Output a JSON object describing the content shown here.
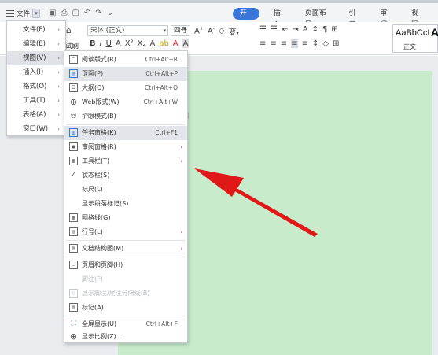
{
  "menubar": {
    "file_button": "文件",
    "tabs": [
      "开始",
      "插入",
      "页面布局",
      "引用",
      "审阅",
      "视图"
    ],
    "active_tab": "开始"
  },
  "ribbon": {
    "font_name": "宋体 (正文)",
    "font_size": "四号",
    "partial_label": "试刷",
    "style_sample": "AaBbCcI",
    "style_name": "正文",
    "style_next": "A"
  },
  "main_menu": [
    {
      "label": "文件(F)"
    },
    {
      "label": "编辑(E)"
    },
    {
      "label": "视图(V)"
    },
    {
      "label": "插入(I)"
    },
    {
      "label": "格式(O)"
    },
    {
      "label": "工具(T)"
    },
    {
      "label": "表格(A)"
    },
    {
      "label": "窗口(W)"
    }
  ],
  "view_menu": [
    {
      "icon": "read-mode-icon",
      "glyph": "▢",
      "label": "阅读版式(R)",
      "shortcut": "Ctrl+Alt+R"
    },
    {
      "icon": "page-view-icon",
      "glyph": "▤",
      "label": "页面(P)",
      "shortcut": "Ctrl+Alt+P",
      "highlight": true
    },
    {
      "icon": "outline-icon",
      "glyph": "☰",
      "label": "大纲(O)",
      "shortcut": "Ctrl+Alt+O"
    },
    {
      "icon": "web-layout-icon",
      "glyph": "⊕",
      "label": "Web版式(W)",
      "shortcut": "Ctrl+Alt+W"
    },
    {
      "icon": "eye-protect-icon",
      "glyph": "◎",
      "label": "护眼模式(B)",
      "shortcut": ""
    },
    {
      "icon": "task-pane-icon",
      "glyph": "▥",
      "label": "任务窗格(K)",
      "shortcut": "Ctrl+F1",
      "highlight": true
    },
    {
      "icon": "review-pane-icon",
      "glyph": "▣",
      "label": "审阅窗格(R)",
      "arrow": true
    },
    {
      "icon": "toolbar-icon",
      "glyph": "▦",
      "label": "工具栏(T)",
      "arrow": true
    },
    {
      "icon": "check-icon",
      "glyph": "✓",
      "label": "状态栏(S)"
    },
    {
      "icon": "",
      "glyph": "",
      "label": "标尺(L)"
    },
    {
      "icon": "",
      "glyph": "",
      "label": "显示段落标记(S)"
    },
    {
      "icon": "gridlines-icon",
      "glyph": "▦",
      "label": "网格线(G)"
    },
    {
      "icon": "line-number-icon",
      "glyph": "▤",
      "label": "行号(L)",
      "arrow": true
    },
    {
      "icon": "doc-structure-icon",
      "glyph": "▤",
      "label": "文档结构图(M)",
      "arrow": true
    },
    {
      "icon": "header-footer-icon",
      "glyph": "▭",
      "label": "页眉和页脚(H)"
    },
    {
      "icon": "footnote-icon",
      "glyph": "",
      "label": "脚注(F)",
      "disabled": true
    },
    {
      "icon": "footnote-separator-icon",
      "glyph": "▯",
      "label": "显示脚注/尾注分隔线(B)",
      "disabled": true
    },
    {
      "icon": "markup-icon",
      "glyph": "▤",
      "label": "标记(A)"
    },
    {
      "icon": "fullscreen-icon",
      "glyph": "⛶",
      "label": "全屏显示(U)",
      "shortcut": "Ctrl+Alt+F"
    },
    {
      "icon": "zoom-icon",
      "glyph": "⊕",
      "label": "显示比例(Z)..."
    }
  ]
}
